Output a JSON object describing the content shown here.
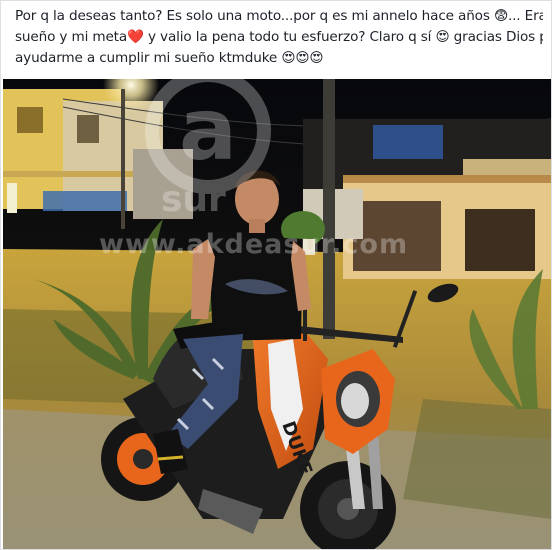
{
  "post": {
    "caption_lines": [
      "Por q la deseas tanto? Es solo una moto...por q es mi annelo hace años 😨... Era mi",
      "sueño y mi meta❤️ y valio la pena todo tu esfuerzo? Claro q sí 😍 gracias Dios por",
      "ayudarme a cumplir mi sueño ktmduke 😍😍😍"
    ]
  },
  "photo": {
    "watermark_text": "www.akdeasur.com",
    "logo_text": "a",
    "logo_subtext": "sur",
    "bike_brand_text": "DUKE"
  },
  "colors": {
    "bike_orange": "#e8661c",
    "sky": "#0c0d12",
    "street": "#d3b04a",
    "wall_yellow": "#e2c35a",
    "text": "#1d2129"
  }
}
